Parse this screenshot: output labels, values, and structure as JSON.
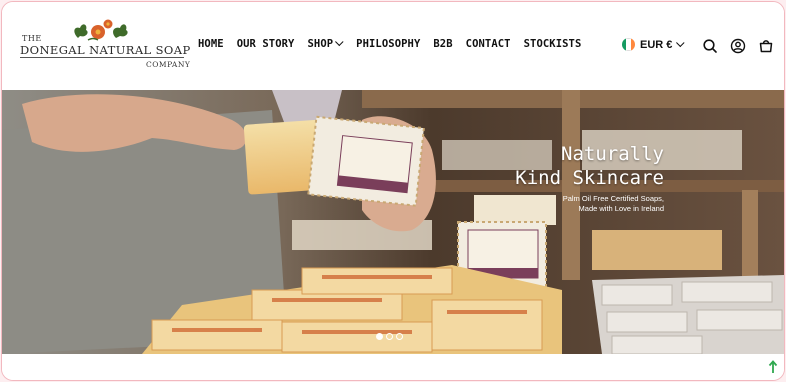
{
  "brand": {
    "the": "THE",
    "name": "DONEGAL NATURAL SOAP",
    "company": "COMPANY"
  },
  "nav": {
    "items": [
      {
        "label": "HOME"
      },
      {
        "label": "OUR STORY"
      },
      {
        "label": "SHOP"
      },
      {
        "label": "PHILOSOPHY"
      },
      {
        "label": "B2B"
      },
      {
        "label": "CONTACT"
      },
      {
        "label": "STOCKISTS"
      }
    ]
  },
  "currency": {
    "label": "EUR €",
    "flag_colors": [
      "#169b62",
      "#ffffff",
      "#ff883e"
    ]
  },
  "header_icons": [
    "search-icon",
    "account-icon",
    "cart-icon"
  ],
  "hero": {
    "title_line1": "Naturally",
    "title_line2": "Kind Skincare",
    "subtitle_line1": "Palm Oil Free Certified Soaps,",
    "subtitle_line2": "Made with Love in Ireland",
    "slides_total": 3,
    "active_slide": 1,
    "box_label_brand": "DONEGAL NATURAL SOAP",
    "box_label_flavor": "WARM ORANGE & SPICE",
    "box_label_foot": "IRISH HANDMADE SOAP"
  },
  "colors": {
    "accent_pink": "#f2b8bf",
    "scroll_top": "#2fa84f"
  }
}
